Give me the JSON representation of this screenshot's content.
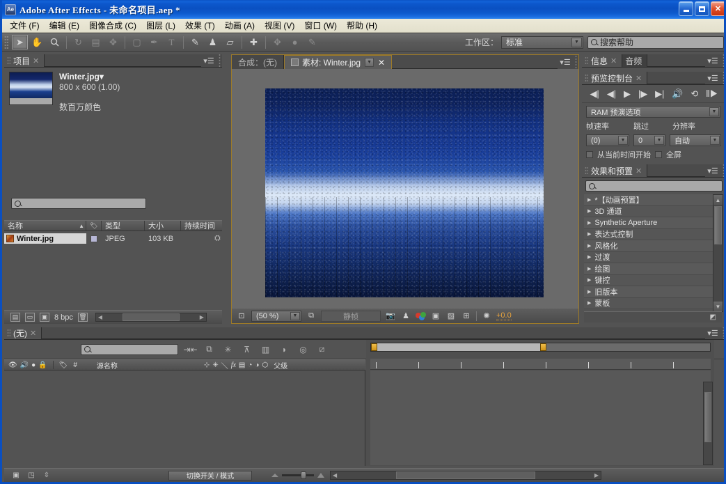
{
  "window": {
    "title": "Adobe After Effects - 未命名项目.aep *",
    "app_badge": "Ae",
    "minimize": "–",
    "maximize": "□",
    "close": "✕"
  },
  "menubar": {
    "items": [
      {
        "label": "文件 (F)"
      },
      {
        "label": "编辑 (E)"
      },
      {
        "label": "图像合成 (C)"
      },
      {
        "label": "图层 (L)"
      },
      {
        "label": "效果 (T)"
      },
      {
        "label": "动画 (A)"
      },
      {
        "label": "视图 (V)"
      },
      {
        "label": "窗口 (W)"
      },
      {
        "label": "帮助 (H)"
      }
    ]
  },
  "toolbar": {
    "workspace_label": "工作区：",
    "workspace_value": "标准",
    "help_placeholder": "搜索帮助",
    "tools": [
      {
        "name": "selection-tool",
        "glyph": "➤"
      },
      {
        "name": "hand-tool",
        "glyph": "✋"
      },
      {
        "name": "zoom-tool",
        "glyph": "🔍"
      },
      {
        "name": "rotation-tool",
        "glyph": "↻"
      },
      {
        "name": "camera-tool",
        "glyph": "🎥"
      },
      {
        "name": "pan-behind-tool",
        "glyph": "✥"
      },
      {
        "name": "shape-tool",
        "glyph": "▭"
      },
      {
        "name": "pen-tool",
        "glyph": "✒"
      },
      {
        "name": "text-tool",
        "glyph": "T"
      },
      {
        "name": "brush-tool",
        "glyph": "🖌"
      },
      {
        "name": "clone-stamp-tool",
        "glyph": "♟"
      },
      {
        "name": "eraser-tool",
        "glyph": "▱"
      },
      {
        "name": "puppet-pin-tool",
        "glyph": "📌"
      }
    ]
  },
  "project": {
    "tab": "项目",
    "close_glyph": "✕",
    "menu_glyph": "▾☰",
    "item_name": "Winter.jpg▾",
    "item_dimensions": "800 x 600 (1.00)",
    "item_color": "数百万颜色",
    "search_placeholder": "",
    "columns": [
      "名称",
      "类型",
      "大小",
      "持续时间"
    ],
    "sort_glyph": "▲",
    "tag_glyph": "🏷",
    "rows": [
      {
        "name": "Winter.jpg",
        "type": "JPEG",
        "size": "103 KB",
        "duration": ""
      }
    ],
    "bit_depth": "8 bpc",
    "footer_icons": [
      "new-comp-icon",
      "new-folder-icon",
      "new-footage-icon",
      "delete-icon"
    ]
  },
  "viewer": {
    "tabs": [
      {
        "label": "合成：(无)",
        "active": false
      },
      {
        "label": "素材: Winter.jpg",
        "active": true
      }
    ],
    "close_glyph": "✕",
    "menu_glyph": "▾☰",
    "zoom_value": "(50 %)",
    "still_label": "静帧",
    "exposure_value": "+0.0",
    "bottom_icons": [
      "region-of-interest-icon",
      "take-snapshot-icon",
      "show-snapshot-icon",
      "channel-rgb-icon",
      "mask-icon",
      "transparency-grid-icon",
      "guides-icon",
      "exposure-icon"
    ]
  },
  "info_panel": {
    "tabs": [
      "信息",
      "音频"
    ],
    "close_glyph": "✕",
    "menu_glyph": "▾☰"
  },
  "preview_panel": {
    "tab": "预览控制台",
    "close_glyph": "✕",
    "menu_glyph": "▾☰",
    "transport": [
      {
        "name": "first-frame-button",
        "glyph": "◀|"
      },
      {
        "name": "previous-frame-button",
        "glyph": "◀|"
      },
      {
        "name": "play-button",
        "glyph": "▶"
      },
      {
        "name": "next-frame-button",
        "glyph": "|▶"
      },
      {
        "name": "last-frame-button",
        "glyph": "▶|"
      },
      {
        "name": "audio-button",
        "glyph": "🔊"
      },
      {
        "name": "loop-button",
        "glyph": "⟲"
      },
      {
        "name": "ram-preview-button",
        "glyph": "⦀▶"
      }
    ],
    "ram_preview_label": "RAM 预演选项",
    "framerate_label": "帧速率",
    "framerate_value": "(0)",
    "skip_label": "跳过",
    "skip_value": "0",
    "resolution_label": "分辨率",
    "resolution_value": "自动",
    "from_current_time_label": "从当前时间开始",
    "fullscreen_label": "全屏"
  },
  "effects_panel": {
    "tab": "效果和预置",
    "close_glyph": "✕",
    "menu_glyph": "▾☰",
    "search_placeholder": "",
    "items": [
      "*【动画预置】",
      "3D 通道",
      "Synthetic Aperture",
      "表达式控制",
      "风格化",
      "过渡",
      "绘图",
      "键控",
      "旧版本",
      "蒙板"
    ],
    "arrow_glyph": "▶"
  },
  "timeline": {
    "tab": "(无)",
    "close_glyph": "✕",
    "menu_glyph": "▾☰",
    "search_placeholder": "",
    "toolbar_icons": [
      "composition-mini-flowchart-icon",
      "draft-3d-icon",
      "hide-shy-layers-icon",
      "frame-blending-icon",
      "motion-blur-icon",
      "graph-editor-icon",
      "brainstorm-icon",
      "auto-keyframe-icon"
    ],
    "column_headers": {
      "video": "👁",
      "audio": "🔊",
      "solo": "●",
      "lock": "🔒",
      "label": "🏷",
      "number": "#",
      "source_name": "源名称",
      "switches": [
        "⊹",
        "✳",
        "＼",
        "fx",
        "▤",
        "◔",
        "◑",
        "⬡"
      ],
      "parent": "父级"
    },
    "switch_modes_button": "切换开关 / 模式",
    "status_icons": [
      "toggle-switches-icon",
      "comp-renderer-icon",
      "stretch-icon"
    ]
  }
}
